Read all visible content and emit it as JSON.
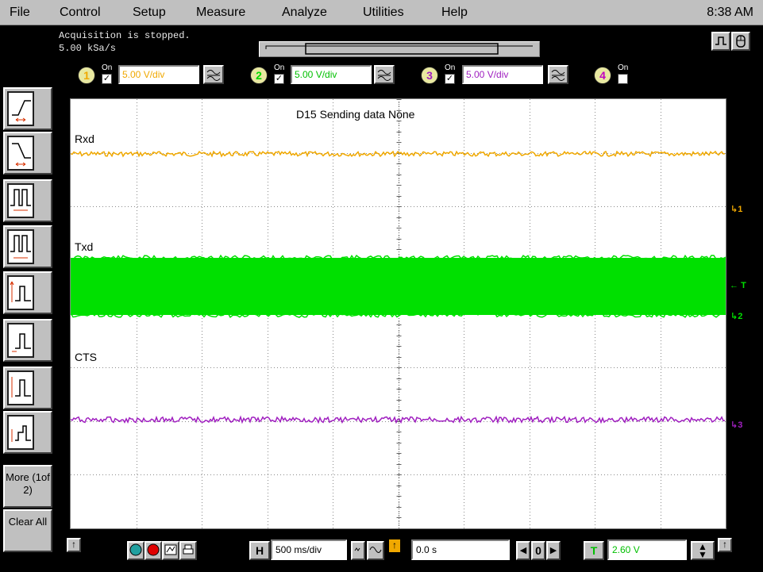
{
  "menu": {
    "items": [
      "File",
      "Control",
      "Setup",
      "Measure",
      "Analyze",
      "Utilities",
      "Help"
    ],
    "clock": "8:38 AM"
  },
  "status": {
    "acquisition": "Acquisition is stopped.",
    "sample_rate": "5.00 kSa/s"
  },
  "channels": [
    {
      "num": "1",
      "on_label": "On",
      "checked": true,
      "scale": "5.00 V/div",
      "color": "#f0a800"
    },
    {
      "num": "2",
      "on_label": "On",
      "checked": true,
      "scale": "5.00 V/div",
      "color": "#00d800"
    },
    {
      "num": "3",
      "on_label": "On",
      "checked": true,
      "scale": "5.00 V/div",
      "color": "#a020c0"
    },
    {
      "num": "4",
      "on_label": "On",
      "checked": false,
      "scale": "",
      "color": "#c000c0"
    }
  ],
  "screen": {
    "title": "D15 Sending data None",
    "traces": [
      {
        "label": "Rxd",
        "color": "#f0a800"
      },
      {
        "label": "Txd",
        "color": "#00e000"
      },
      {
        "label": "CTS",
        "color": "#a020c0"
      }
    ],
    "markers": {
      "ch1": "1",
      "trigger": "T",
      "ch2": "2",
      "ch3": "3"
    }
  },
  "left_toolbar": {
    "more_label": "More (1of 2)",
    "clear_label": "Clear All"
  },
  "bottom": {
    "horizontal_button": "H",
    "timebase": "500 ms/div",
    "position": "0.0 s",
    "trigger_button": "T",
    "trigger_level": "2.60 V",
    "nav_center": "0"
  },
  "colors": {
    "ch1": "#f0a800",
    "ch2": "#00e000",
    "ch3": "#a020c0",
    "ch4": "#c000c0",
    "grid": "#8a8a8a"
  }
}
